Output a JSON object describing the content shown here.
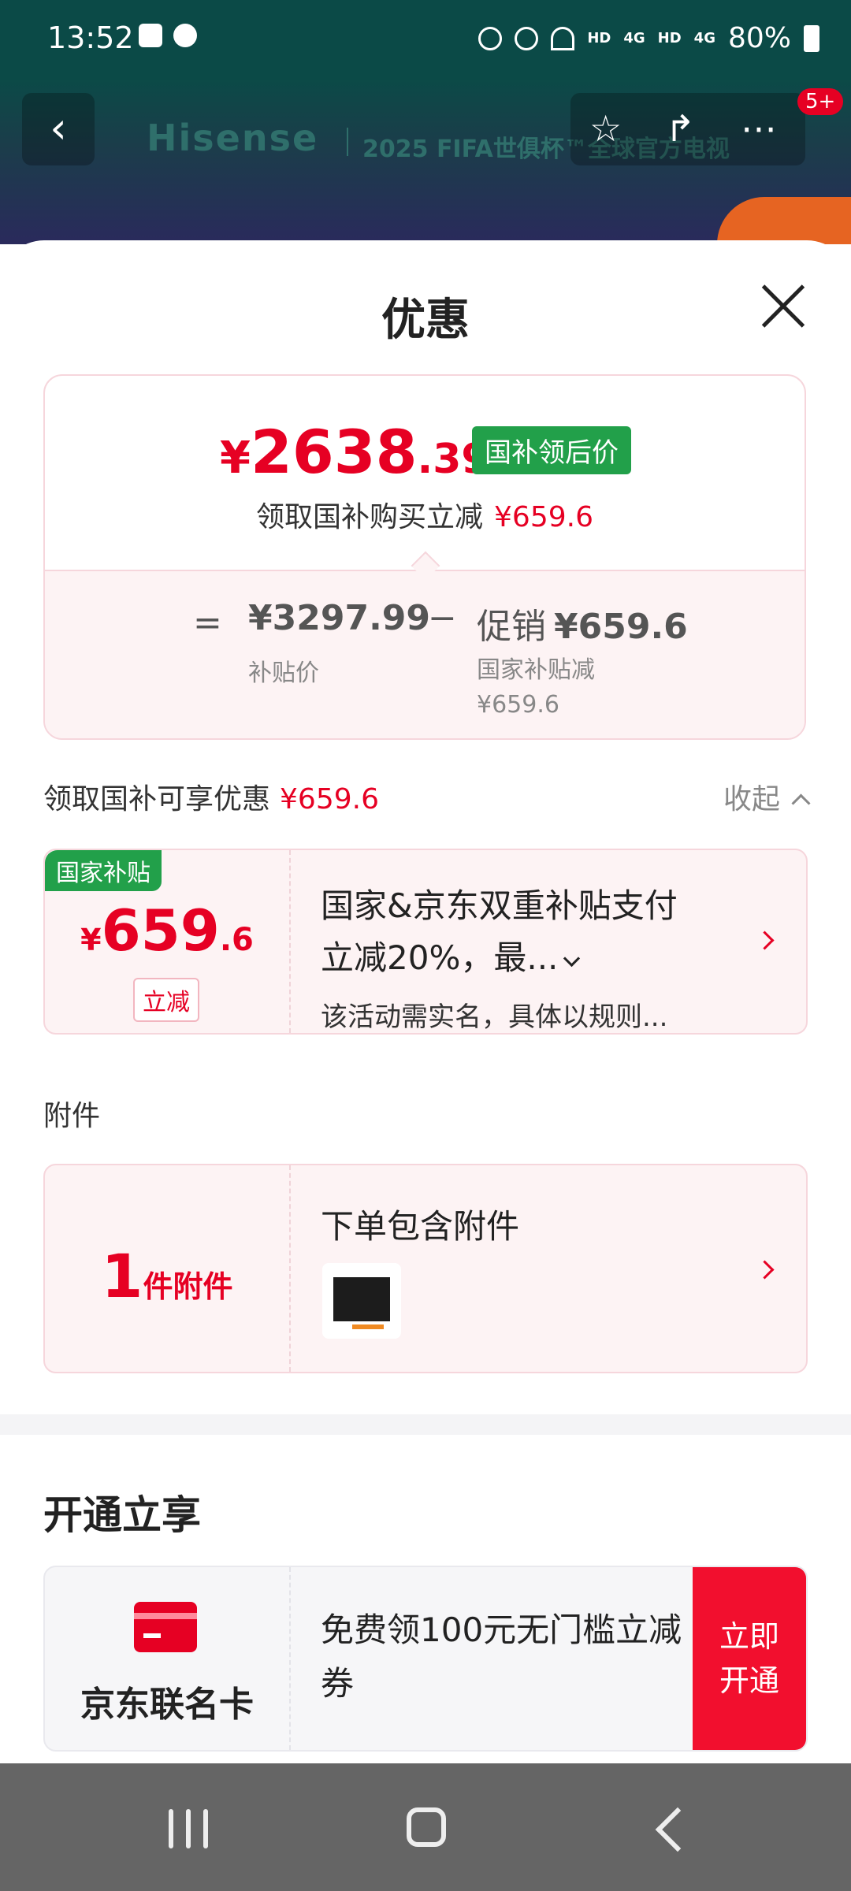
{
  "status_bar": {
    "time": "13:52",
    "hd1": "HD",
    "net1": "4G",
    "hd2": "HD",
    "net2": "4G",
    "battery": "80%"
  },
  "header": {
    "brand": "Hisense",
    "slogan": "2025 FIFA世俱杯™全球官方电视",
    "back_icon": "‹",
    "badge": "5+",
    "icons": [
      "star-icon",
      "share-icon",
      "more-icon"
    ]
  },
  "sheet": {
    "title": "优惠",
    "close_icon": "close-icon"
  },
  "price_card": {
    "yen": "¥",
    "price_int": "2638",
    "price_dec": ".39",
    "tag": "国补领后价",
    "subtitle": "领取国补购买立减",
    "subtitle_amount": "¥659.6",
    "equals": "=",
    "subsidy_price": "¥3297.99",
    "subsidy_price_label": "补贴价",
    "minus": "−",
    "promo_label": "促销",
    "promo_amount": "¥659.6",
    "promo_note": "国家补贴减 ¥659.6"
  },
  "discount": {
    "text": "领取国补可享优惠",
    "amount": "¥659.6",
    "collapse_label": "收起"
  },
  "subsidy_coupon": {
    "tag": "国家补贴",
    "yen": "¥",
    "amount_int": "659",
    "amount_dec": ".6",
    "pill": "立减",
    "desc_line1": "国家&京东双重补贴支付",
    "desc_line2": "立减20%，最...",
    "desc_sub": "该活动需实名，具体以规则..."
  },
  "accessory": {
    "section_label": "附件",
    "count": "1",
    "count_unit": "件附件",
    "title": "下单包含附件"
  },
  "membership": {
    "section_title": "开通立享",
    "card_name": "京东联名卡",
    "card_desc": "免费领100元无门槛立减券",
    "open_button": "立即开通"
  },
  "colors": {
    "accent_red": "#e60023",
    "subsidy_green": "#22a04a",
    "header_teal": "#0b4a47",
    "nav_gray": "#656565"
  }
}
